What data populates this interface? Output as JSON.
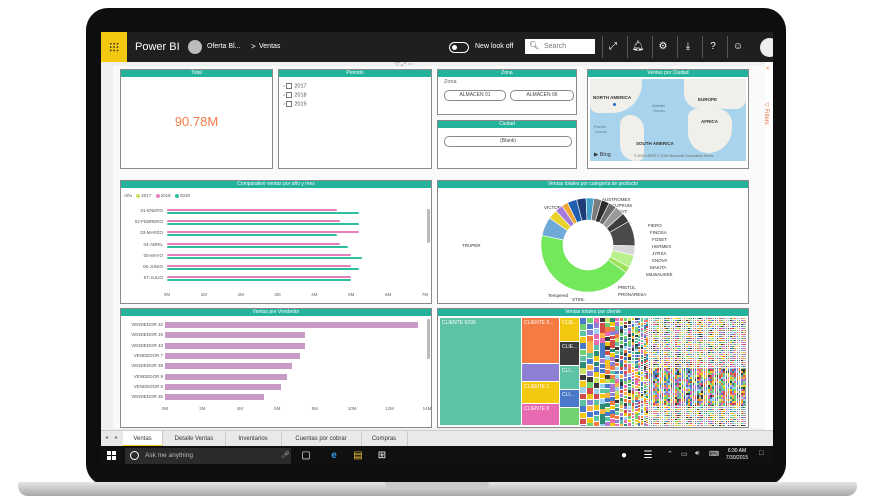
{
  "app": {
    "name": "Power BI",
    "breadcrumb": [
      "Oferta Bl...",
      "Ventas"
    ],
    "breadcrumb_separator": ">",
    "new_look_label": "New look off",
    "search_placeholder": "Search",
    "brand_color": "#f2c811",
    "icons": [
      "expand-icon",
      "bell-icon",
      "gear-icon",
      "download-icon",
      "help-icon",
      "smiley-icon"
    ]
  },
  "visuals": {
    "total": {
      "title": "Total",
      "value": "90.78M",
      "value_color": "#f57b44"
    },
    "periodo": {
      "title": "Periodo",
      "items": [
        "2017",
        "2018",
        "2019"
      ]
    },
    "zona": {
      "title": "Zona",
      "label": "Zona",
      "options": [
        "ALMACEN 01",
        "ALMACEN 06"
      ]
    },
    "ciudad": {
      "title": "Ciudad",
      "options": [
        "(Blank)"
      ]
    },
    "mapa": {
      "title": "Ventas por Ciudad",
      "labels": [
        "NORTH AMERICA",
        "EUROPE",
        "AFRICA",
        "SOUTH AMERICA"
      ],
      "oceans": [
        "Atlantic",
        "Ocean",
        "Pacific",
        "Ocean"
      ],
      "provider": "Bing",
      "copyright": "© 2020 HERE © 2020 Microsoft Corporation  Terms"
    },
    "comparativo": {
      "title": "Comparativo ventas por año y mes"
    },
    "categoria": {
      "title": "Ventas totales por categoría de producto"
    },
    "vendedor": {
      "title": "Ventas por Vendedor"
    },
    "cliente": {
      "title": "Ventas totales por cliente",
      "tiles": [
        "CLIENTE 6290",
        "CLIENTE 5...",
        "CLIE...",
        "CLIE...",
        "CLIENTE 1",
        "CLI...",
        "CLI...",
        "CLIENTE 6"
      ]
    }
  },
  "chart_data": [
    {
      "type": "bar",
      "orientation": "horizontal",
      "title": "Comparativo ventas por año y mes",
      "legend_title": "Año",
      "legend_position": "top-left",
      "categories": [
        "01-ENERO",
        "02-FEBRERO",
        "03-MARZO",
        "04-ABRIL",
        "05-MAYO",
        "06-JUNIO",
        "07-JULIO"
      ],
      "series": [
        {
          "name": "2017",
          "color": "#c9e265",
          "values": [
            0,
            0,
            0,
            0,
            0,
            0,
            0
          ]
        },
        {
          "name": "2018",
          "color": "#e77fbf",
          "values": [
            4.6,
            4.7,
            5.2,
            4.7,
            5.0,
            5.0,
            5.0
          ]
        },
        {
          "name": "2019",
          "color": "#2dbf9f",
          "values": [
            5.2,
            5.2,
            4.6,
            4.9,
            5.3,
            5.2,
            5.0
          ]
        }
      ],
      "x_ticks": [
        "0M",
        "1M",
        "2M",
        "3M",
        "4M",
        "5M",
        "6M",
        "7M"
      ],
      "xlim": [
        0,
        7
      ],
      "grid": false
    },
    {
      "type": "pie",
      "variant": "donut",
      "title": "Ventas totales por categoría de producto",
      "categories": [
        "TRUPER",
        "VICTORINOX",
        "AUSTROMEX",
        "CUPRUM",
        "DHT",
        "FIERO",
        "FINOSA",
        "FOSET",
        "HERMEX",
        "JYRSA",
        "KNOVA",
        "MAKITA",
        "MILWAUKEE",
        "PRETUL",
        "PRONARESA",
        "STIHL",
        "Tempered"
      ],
      "values": [
        40,
        6,
        3,
        2.5,
        2,
        3,
        3,
        2.5,
        2.5,
        2.5,
        2.5,
        3,
        3,
        8,
        3,
        4,
        2
      ],
      "colors": [
        "#72e85a",
        "#6fa9d8",
        "#e8d22b",
        "#a47adc",
        "#f0a830",
        "#1f5fae",
        "#1d3c78",
        "#45a0c8",
        "#7c7c7c",
        "#2a2a2a",
        "#6c6c6c",
        "#9a9a9a",
        "#3d3d3d",
        "#4b4b4b",
        "#d7d7d7",
        "#b7f08c",
        "#9ce15a"
      ]
    },
    {
      "type": "bar",
      "orientation": "horizontal",
      "title": "Ventas por Vendedor",
      "categories": [
        "VENDEDOR 32",
        "VENDEDOR 15",
        "VENDEDOR 40",
        "VENDEDOR 7",
        "VENDEDOR 38",
        "VENDEDOR 8",
        "VENDEDOR 5",
        "VENDEDOR 35"
      ],
      "values": [
        13.5,
        7.5,
        7.5,
        7.2,
        6.8,
        6.5,
        6.2,
        5.3
      ],
      "color": "#c79bc6",
      "x_ticks": [
        "0M",
        "2M",
        "4M",
        "6M",
        "8M",
        "10M",
        "12M",
        "14M"
      ],
      "xlim": [
        0,
        14
      ],
      "grid": false
    },
    {
      "type": "treemap",
      "title": "Ventas totales por cliente",
      "categories": [
        "CLIENTE 6290",
        "CLIENTE 5...",
        "CLIE...",
        "CLIE...",
        "CLIENTE 1",
        "CLI...",
        "CLI...",
        "CLIENTE 6"
      ]
    }
  ],
  "tabs": [
    "Ventas",
    "Detalle Ventas",
    "Inventarios",
    "Cuentas por cobrar",
    "Compras"
  ],
  "taskbar": {
    "search_placeholder": "Ask me anything",
    "time": "6:30 AM",
    "date": "7/30/2015"
  }
}
